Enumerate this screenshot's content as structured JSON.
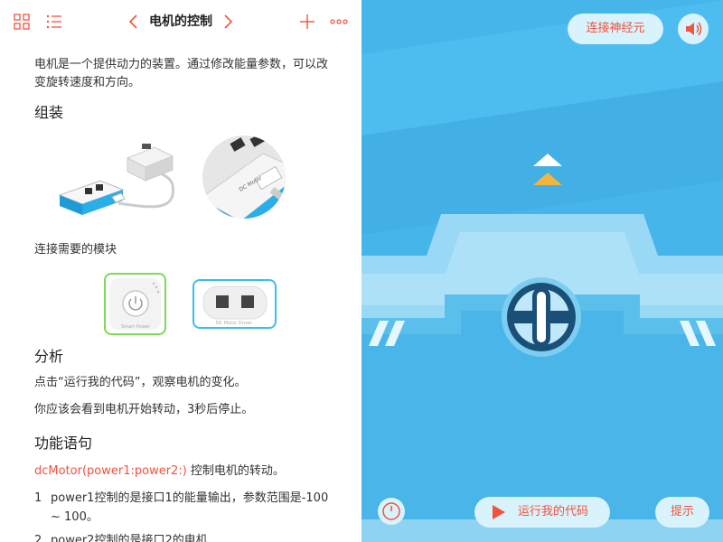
{
  "header": {
    "title": "电机的控制"
  },
  "lesson": {
    "intro": "电机是一个提供动力的装置。通过修改能量参数，可以改变旋转速度和方向。",
    "section_assemble": "组装",
    "modules_label": "连接需要的模块",
    "power_module_caption": "Smart Power",
    "motor_module_caption": "DC Motor Driver",
    "motor_label_on_image": "DC Motor",
    "section_analysis": "分析",
    "analysis_1": "点击“运行我的代码”，观察电机的变化。",
    "analysis_2": "你应该会看到电机开始转动，3秒后停止。",
    "section_function": "功能语句",
    "func_code": "dcMotor(power1:power2:)",
    "func_desc": " 控制电机的转动。",
    "items": [
      {
        "num": "1",
        "text": "power1控制的是接口1的能量输出，参数范围是-100 ~ 100。"
      },
      {
        "num": "2",
        "text": "power2控制的是接口2的电机"
      }
    ]
  },
  "stage": {
    "connect_label": "连接神经元",
    "run_label": "运行我的代码",
    "hint_label": "提示"
  },
  "colors": {
    "accent": "#f0533e",
    "stage_bg": "#46b6ea",
    "button_bg": "#d9f3fc",
    "power_border": "#7ed957",
    "motor_border": "#3bbdf0"
  },
  "icons": {
    "grid": "grid-icon",
    "list": "list-icon",
    "prev": "chevron-left-icon",
    "next": "chevron-right-icon",
    "add": "plus-icon",
    "more": "more-icon",
    "sound": "speaker-icon",
    "speed": "speedometer-icon",
    "play": "play-icon"
  }
}
